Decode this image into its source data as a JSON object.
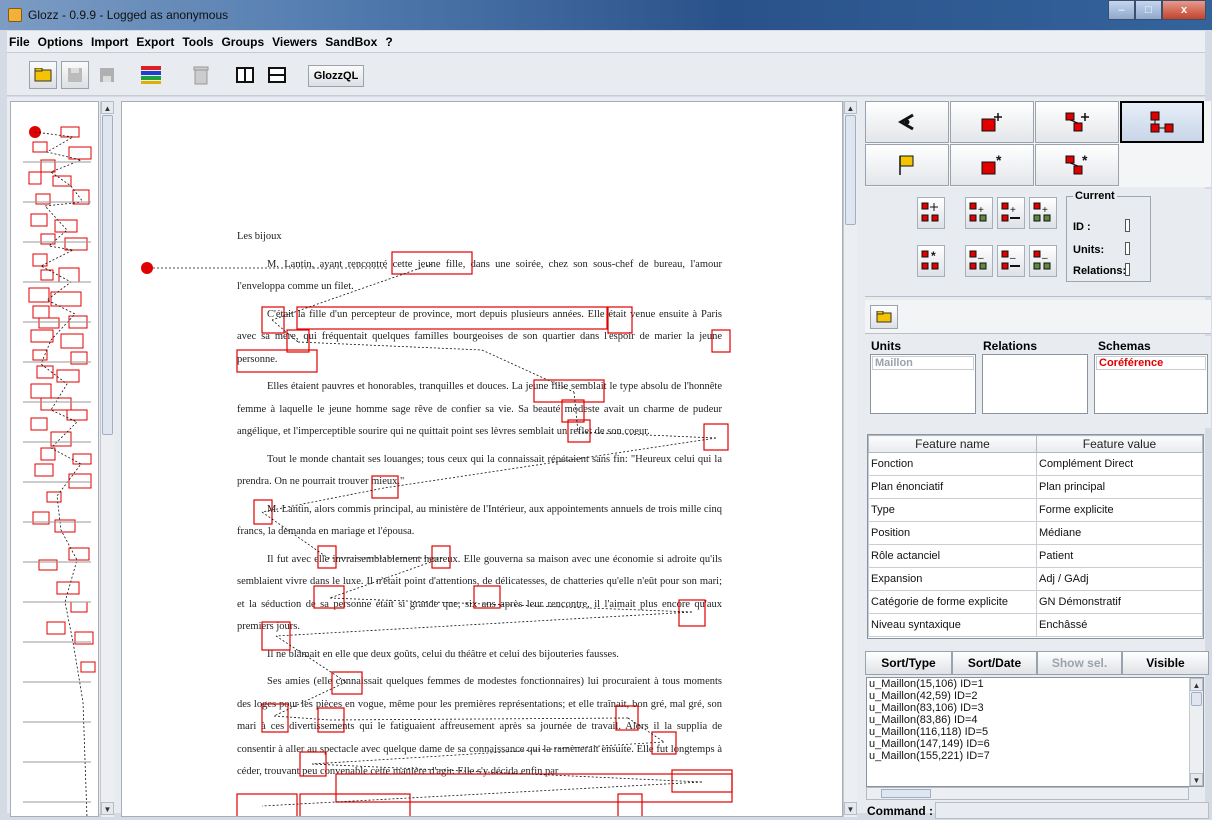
{
  "window": {
    "title": "Glozz - 0.9.9 - Logged as anonymous",
    "minimize": "–",
    "maximize": "□",
    "close": "x"
  },
  "menu": [
    "File",
    "Options",
    "Import",
    "Export",
    "Tools",
    "Groups",
    "Viewers",
    "SandBox",
    "?"
  ],
  "toolbar": {
    "glozzql_label": "GlozzQL"
  },
  "document": {
    "title": "Les bijoux",
    "paragraphs": [
      "M. Lantin, ayant rencontré cette jeune fille, dans une soirée, chez son sous-chef de bureau, l'amour l'enveloppa comme un filet.",
      "C'était la fille d'un percepteur de province, mort depuis plusieurs années. Elle était venue ensuite à Paris avec sa mère, qui fréquentait quelques familles bourgeoises de son quartier dans l'espoir de marier la jeune personne.",
      "Elles étaient pauvres et honorables, tranquilles et douces. La jeune fille semblait le type absolu de l'honnête femme à laquelle le jeune homme sage rêve de confier sa vie. Sa beauté modeste avait un charme de pudeur angélique, et l'imperceptible sourire qui ne quittait point ses lèvres semblait un reflet de son coeur.",
      "Tout le monde chantait ses louanges; tous ceux qui la connaissait répétaient sans fin: \"Heureux celui qui la prendra. On ne pourrait trouver mieux.\"",
      "M. Lantin, alors commis principal, au ministère de l'Intérieur, aux appointements annuels de trois mille cinq francs, la demanda en mariage et l'épousa.",
      "Il fut avec elle invraisemblablement heureux. Elle gouverna sa maison avec une économie si adroite qu'ils semblaient vivre dans le luxe. Il n'était point d'attentions, de délicatesses, de chatteries qu'elle n'eût pour son mari; et la séduction de sa personne était si grande que, six ans après leur rencontre, il l'aimait plus encore qu'aux premiers jours.",
      "Il ne blâmait en elle que deux goûts, celui du théâtre et celui des bijouteries fausses.",
      "Ses amies (elle connaissait quelques femmes de modestes fonctionnaires) lui procuraient à tous moments des loges pour les pièces en vogue, même pour les premières représentations; et elle traînait, bon gré, mal gré, son mari à ces divertissements qui le fatiguaient affreusement après sa journée de travail. Alors il la supplia de consentir à aller au spectacle avec quelque dame de sa connaissance qui la ramènerait ensuite. Elle fut longtemps à céder, trouvant peu convenable cette manière d'agir. Elle s'y décida enfin par"
    ]
  },
  "current": {
    "title": "Current",
    "id_label": "ID :",
    "units_label": "Units:",
    "relations_label": "Relations:"
  },
  "lists": {
    "units_header": "Units",
    "relations_header": "Relations",
    "schemas_header": "Schemas",
    "units_items": [
      "Maillon"
    ],
    "schemas_items": [
      "Coréférence"
    ]
  },
  "features": {
    "col_name": "Feature name",
    "col_value": "Feature value",
    "rows": [
      [
        "Fonction",
        "Complément Direct"
      ],
      [
        "Plan énonciatif",
        "Plan principal"
      ],
      [
        "Type",
        "Forme explicite"
      ],
      [
        "Position",
        "Médiane"
      ],
      [
        "Rôle actanciel",
        "Patient"
      ],
      [
        "Expansion",
        "Adj / GAdj"
      ],
      [
        "Catégorie de forme explicite",
        "GN Démonstratif"
      ],
      [
        "Niveau syntaxique",
        "Enchâssé"
      ]
    ]
  },
  "sort": {
    "type": "Sort/Type",
    "date": "Sort/Date",
    "show_sel": "Show sel.",
    "visible": "Visible"
  },
  "unit_list": [
    "u_Maillon(15,106) ID=1",
    "u_Maillon(42,59) ID=2",
    "u_Maillon(83,106) ID=3",
    "u_Maillon(83,86) ID=4",
    "u_Maillon(116,118) ID=5",
    "u_Maillon(147,149) ID=6",
    "u_Maillon(155,221) ID=7"
  ],
  "command": {
    "label": "Command :"
  },
  "colors": {
    "annotation": "#e00000",
    "accent": "#f5c400"
  }
}
